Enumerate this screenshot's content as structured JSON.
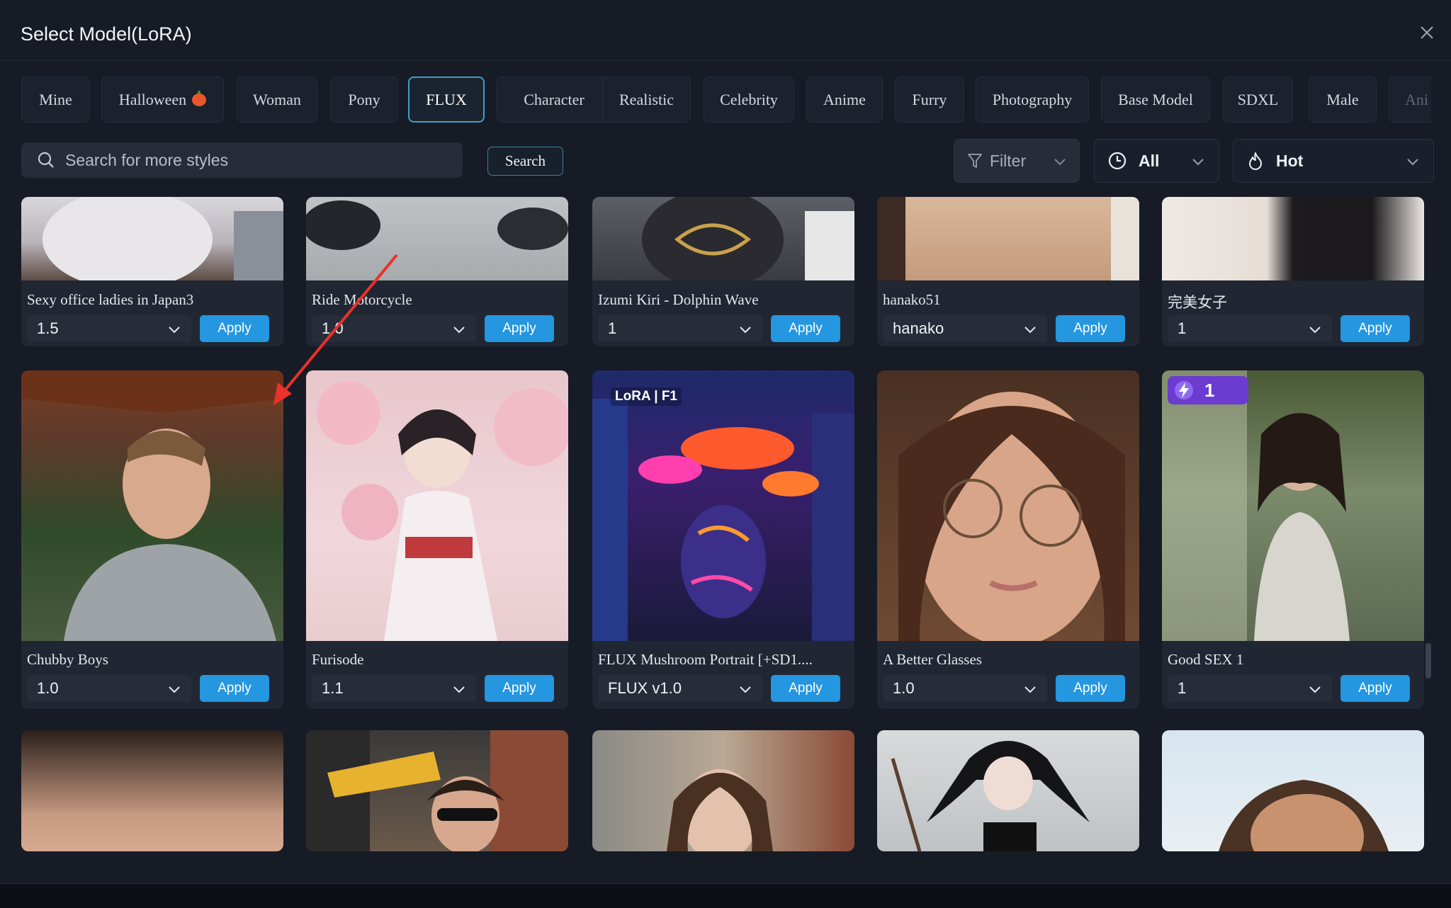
{
  "dialog": {
    "title": "Select Model(LoRA)"
  },
  "tabs": [
    {
      "label": "Mine"
    },
    {
      "label": "Halloween"
    },
    {
      "label": "Woman"
    },
    {
      "label": "Pony"
    },
    {
      "label": "FLUX",
      "active": true
    },
    {
      "label": "Character"
    },
    {
      "label": "Realistic"
    },
    {
      "label": "Celebrity"
    },
    {
      "label": "Anime"
    },
    {
      "label": "Furry"
    },
    {
      "label": "Photography"
    },
    {
      "label": "Base Model"
    },
    {
      "label": "SDXL"
    },
    {
      "label": "Male"
    },
    {
      "label": "Ani"
    }
  ],
  "search": {
    "placeholder": "Search for more styles",
    "button_label": "Search"
  },
  "filters": {
    "filter_label": "Filter",
    "time_label": "All",
    "sort_label": "Hot"
  },
  "cards": [
    {
      "name": "Sexy office ladies in Japan3",
      "version": "1.5",
      "apply": "Apply"
    },
    {
      "name": "Ride Motorcycle",
      "version": "1.0",
      "apply": "Apply"
    },
    {
      "name": "Izumi Kiri - Dolphin Wave",
      "version": "1",
      "apply": "Apply"
    },
    {
      "name": "hanako51",
      "version": "hanako",
      "apply": "Apply"
    },
    {
      "name": "完美女子",
      "version": "1",
      "apply": "Apply"
    },
    {
      "name": "Chubby Boys",
      "version": "1.0",
      "apply": "Apply"
    },
    {
      "name": "Furisode",
      "version": "1.1",
      "apply": "Apply"
    },
    {
      "name": "FLUX Mushroom Portrait [+SD1....",
      "version": "FLUX v1.0",
      "apply": "Apply",
      "badge": "LoRA | F1"
    },
    {
      "name": "A Better Glasses",
      "version": "1.0",
      "apply": "Apply"
    },
    {
      "name": "Good SEX 1",
      "version": "1",
      "apply": "Apply",
      "count_badge": "1"
    }
  ],
  "colors": {
    "accent": "#2596e0",
    "active_tab_border": "#3da0c9",
    "annotation_arrow": "#e8322a"
  }
}
